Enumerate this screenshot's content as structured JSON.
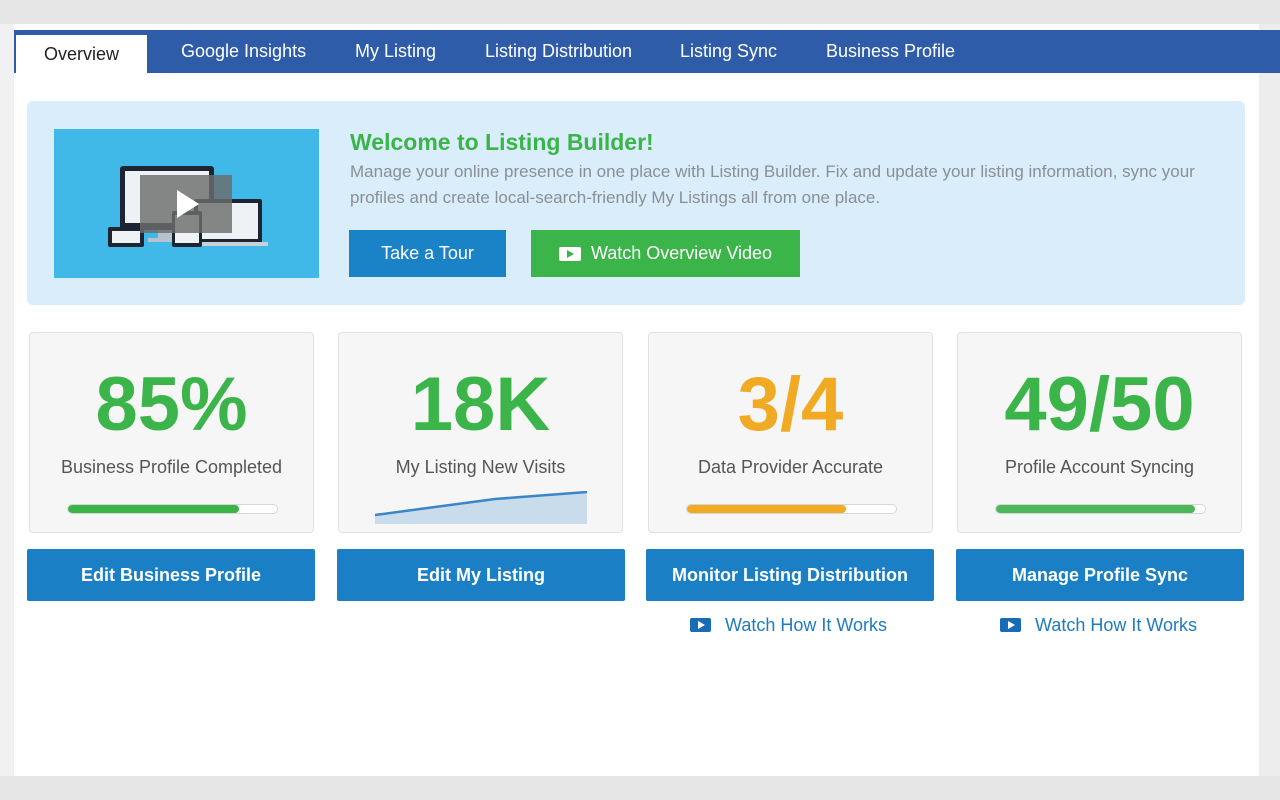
{
  "nav": {
    "tabs": [
      {
        "label": "Overview",
        "active": true
      },
      {
        "label": "Google Insights"
      },
      {
        "label": "My Listing"
      },
      {
        "label": "Listing Distribution"
      },
      {
        "label": "Listing Sync"
      },
      {
        "label": "Business Profile"
      }
    ]
  },
  "banner": {
    "title": "Welcome to Listing Builder!",
    "description": "Manage your online presence in one place with Listing Builder. Fix and update your listing information, sync your profiles and create local-search-friendly My Listings all from one place.",
    "tour_label": "Take a Tour",
    "video_label": "Watch Overview Video",
    "thumbnail_icon": "devices-play-icon"
  },
  "cards": [
    {
      "value": "85%",
      "label": "Business Profile Completed",
      "color": "#3bb44a",
      "progress": 0.82,
      "bar_color": "#3bb44a",
      "action": "Edit Business Profile"
    },
    {
      "value": "18K",
      "label": "My Listing New Visits",
      "color": "#3bb44a",
      "trend": "sparkline",
      "spark_color": "#3a86c8",
      "spark_fill": "#c9dcec",
      "action": "Edit My Listing"
    },
    {
      "value": "3/4",
      "label": "Data Provider Accurate",
      "color": "#f0aa23",
      "progress": 0.76,
      "bar_color": "#f0aa23",
      "action": "Monitor Listing Distribution",
      "how_label": "Watch How It Works"
    },
    {
      "value": "49/50",
      "label": "Profile Account Syncing",
      "color": "#3bb44a",
      "progress": 0.95,
      "bar_color": "#4bb85a",
      "action": "Manage Profile Sync",
      "how_label": "Watch How It Works"
    }
  ],
  "colors": {
    "nav_bg": "#2e5ca8",
    "accent_blue": "#1a7fc4",
    "accent_green": "#3bb44a",
    "accent_orange": "#f0aa23",
    "banner_bg": "#d9eefa"
  }
}
